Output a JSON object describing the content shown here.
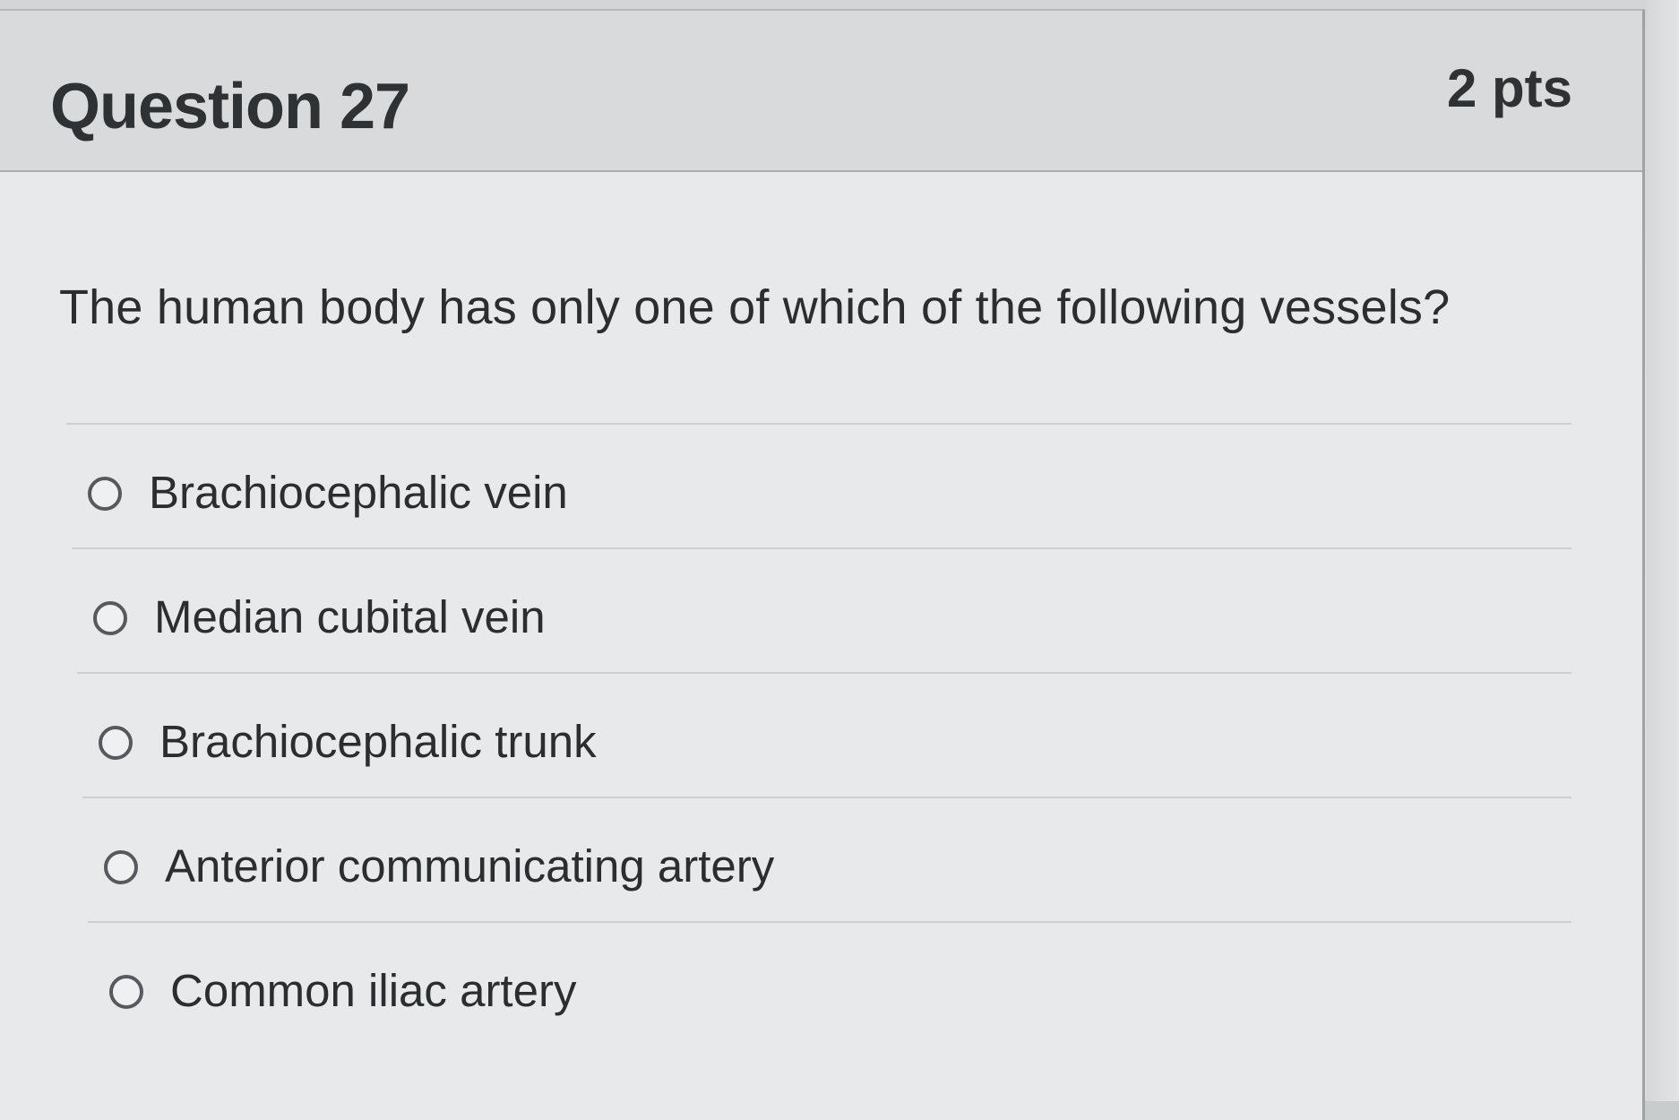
{
  "question": {
    "title": "Question 27",
    "points": "2 pts",
    "text": "The human body has only one of which of the following vessels?"
  },
  "answers": [
    {
      "label": "Brachiocephalic vein",
      "selected": false
    },
    {
      "label": "Median cubital vein",
      "selected": false
    },
    {
      "label": "Brachiocephalic trunk",
      "selected": false
    },
    {
      "label": "Anterior communicating artery",
      "selected": false
    },
    {
      "label": "Common iliac artery",
      "selected": false
    }
  ]
}
